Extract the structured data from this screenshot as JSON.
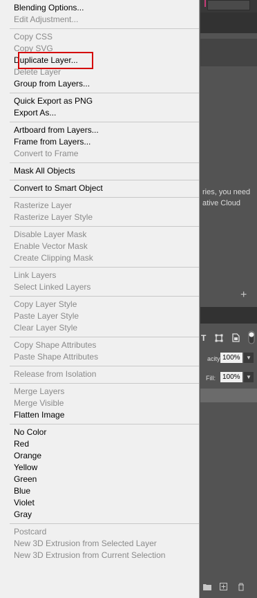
{
  "context_menu": {
    "groups": [
      {
        "items": [
          {
            "label": "Blending Options...",
            "enabled": true
          },
          {
            "label": "Edit Adjustment...",
            "enabled": false
          }
        ]
      },
      {
        "items": [
          {
            "label": "Copy CSS",
            "enabled": false
          },
          {
            "label": "Copy SVG",
            "enabled": false
          },
          {
            "label": "Duplicate Layer...",
            "enabled": true,
            "highlighted": true
          },
          {
            "label": "Delete Layer",
            "enabled": false
          },
          {
            "label": "Group from Layers...",
            "enabled": true
          }
        ]
      },
      {
        "items": [
          {
            "label": "Quick Export as PNG",
            "enabled": true
          },
          {
            "label": "Export As...",
            "enabled": true
          }
        ]
      },
      {
        "items": [
          {
            "label": "Artboard from Layers...",
            "enabled": true
          },
          {
            "label": "Frame from Layers...",
            "enabled": true
          },
          {
            "label": "Convert to Frame",
            "enabled": false
          }
        ]
      },
      {
        "items": [
          {
            "label": "Mask All Objects",
            "enabled": true
          }
        ]
      },
      {
        "items": [
          {
            "label": "Convert to Smart Object",
            "enabled": true
          }
        ]
      },
      {
        "items": [
          {
            "label": "Rasterize Layer",
            "enabled": false
          },
          {
            "label": "Rasterize Layer Style",
            "enabled": false
          }
        ]
      },
      {
        "items": [
          {
            "label": "Disable Layer Mask",
            "enabled": false
          },
          {
            "label": "Enable Vector Mask",
            "enabled": false
          },
          {
            "label": "Create Clipping Mask",
            "enabled": false
          }
        ]
      },
      {
        "items": [
          {
            "label": "Link Layers",
            "enabled": false
          },
          {
            "label": "Select Linked Layers",
            "enabled": false
          }
        ]
      },
      {
        "items": [
          {
            "label": "Copy Layer Style",
            "enabled": false
          },
          {
            "label": "Paste Layer Style",
            "enabled": false
          },
          {
            "label": "Clear Layer Style",
            "enabled": false
          }
        ]
      },
      {
        "items": [
          {
            "label": "Copy Shape Attributes",
            "enabled": false
          },
          {
            "label": "Paste Shape Attributes",
            "enabled": false
          }
        ]
      },
      {
        "items": [
          {
            "label": "Release from Isolation",
            "enabled": false
          }
        ]
      },
      {
        "items": [
          {
            "label": "Merge Layers",
            "enabled": false
          },
          {
            "label": "Merge Visible",
            "enabled": false
          },
          {
            "label": "Flatten Image",
            "enabled": true
          }
        ]
      },
      {
        "items": [
          {
            "label": "No Color",
            "enabled": true
          },
          {
            "label": "Red",
            "enabled": true
          },
          {
            "label": "Orange",
            "enabled": true
          },
          {
            "label": "Yellow",
            "enabled": true
          },
          {
            "label": "Green",
            "enabled": true
          },
          {
            "label": "Blue",
            "enabled": true
          },
          {
            "label": "Violet",
            "enabled": true
          },
          {
            "label": "Gray",
            "enabled": true
          }
        ]
      },
      {
        "items": [
          {
            "label": "Postcard",
            "enabled": false
          },
          {
            "label": "New 3D Extrusion from Selected Layer",
            "enabled": false
          },
          {
            "label": "New 3D Extrusion from Current Selection",
            "enabled": false
          }
        ]
      }
    ]
  },
  "background": {
    "libraries_text_line1": "ries, you need",
    "libraries_text_line2": "ative Cloud",
    "opacity_label": "acity:",
    "opacity_value": "100%",
    "fill_label": "Fill:",
    "fill_value": "100%"
  },
  "colors": {
    "highlight_border": "#d40000",
    "menu_background": "#f0f0f0",
    "disabled_text": "#8a8a8a"
  }
}
